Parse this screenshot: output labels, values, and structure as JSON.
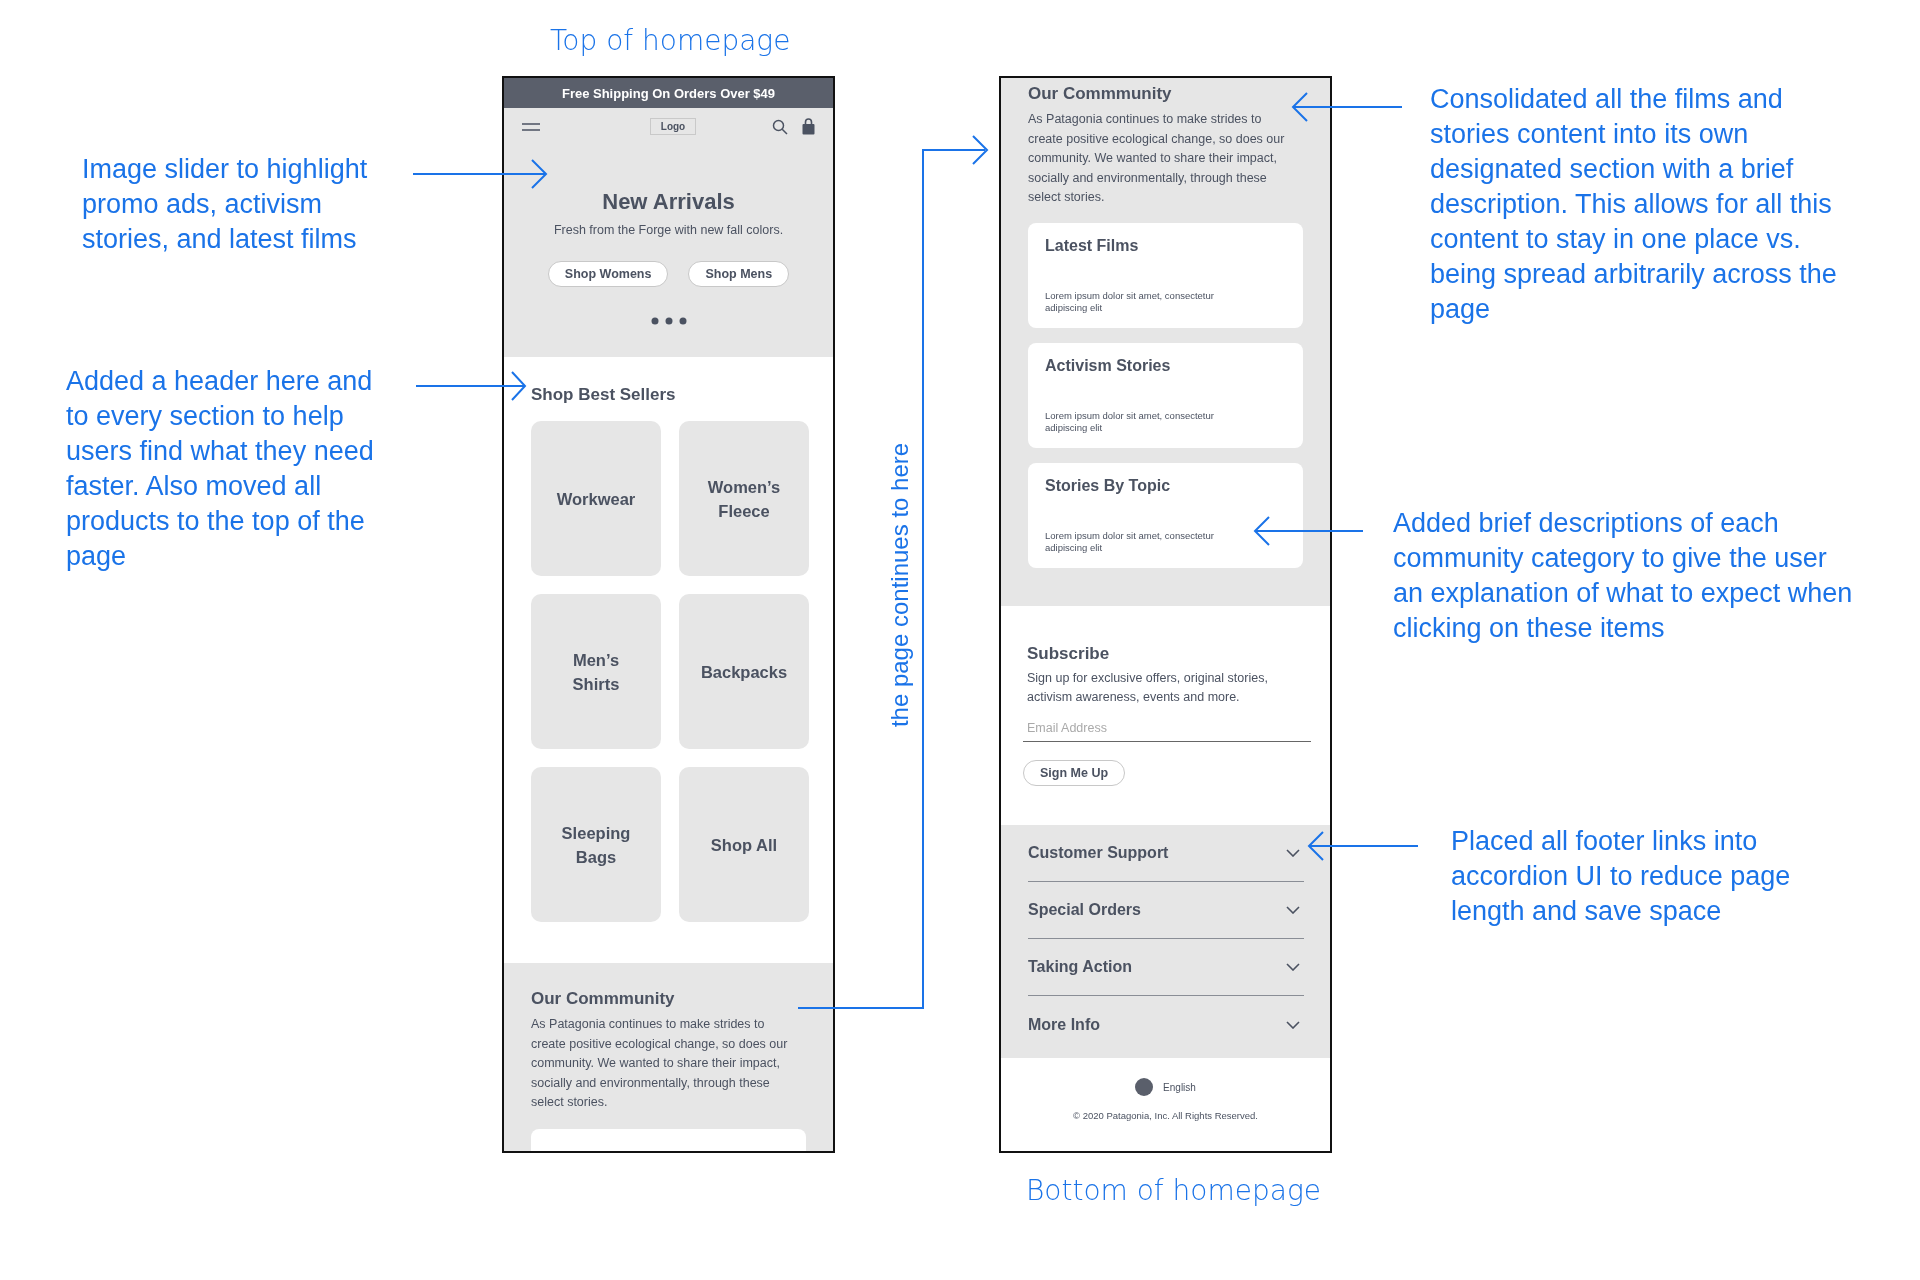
{
  "captions": [
    {
      "kind": "top",
      "text": "Top of homepage"
    },
    {
      "kind": "bottom",
      "text": "Bottom of homepage"
    }
  ],
  "notes": [
    {
      "kind": "slider",
      "text": "Image slider to highlight promo ads, activism stories, and latest films"
    },
    {
      "kind": "header",
      "text": "Added a header here and to every section to help users find what they need faster. Also moved all products to the top of the page"
    },
    {
      "kind": "continues",
      "text": "the page continues to here"
    },
    {
      "kind": "community",
      "text": "Consolidated all the films and stories content into its own designated section with a brief description. This allows for all this content to stay in one place vs. being spread arbitrarily across the page"
    },
    {
      "kind": "descriptions",
      "text": "Added brief descriptions of each community category to give the user an explanation of what to expect when clicking on these items"
    },
    {
      "kind": "footer",
      "text": "Placed all footer links into accordion UI to reduce page length and save space"
    }
  ],
  "top_page": {
    "banner": "Free Shipping On Orders Over $49",
    "logo": "Logo",
    "hero": {
      "title": "New Arrivals",
      "subtitle": "Fresh from the Forge with new fall colors.",
      "buttons": [
        "Shop Womens",
        "Shop Mens"
      ]
    },
    "best_sellers": {
      "title": "Shop Best Sellers",
      "tiles": [
        "Workwear",
        "Women’s Fleece",
        "Men’s Shirts",
        "Backpacks",
        "Sleeping Bags",
        "Shop All"
      ]
    },
    "community": {
      "title": "Our Commmunity",
      "text": "As Patagonia continues to make strides to create positive ecological change, so does our community. We wanted to share their impact, socially and environmentally, through these select stories."
    }
  },
  "bottom_page": {
    "community": {
      "title": "Our Commmunity",
      "text": "As Patagonia continues to make strides to create positive ecological change, so does our community. We wanted to share their impact, socially and environmentally, through these select stories.",
      "cards": [
        {
          "title": "Latest Films",
          "text": "Lorem ipsum dolor sit amet, consectetur adipiscing elit"
        },
        {
          "title": "Activism Stories",
          "text": "Lorem ipsum dolor sit amet, consectetur adipiscing elit"
        },
        {
          "title": "Stories By Topic",
          "text": "Lorem ipsum dolor sit amet, consectetur adipiscing elit"
        }
      ]
    },
    "subscribe": {
      "title": "Subscribe",
      "text": "Sign up for exclusive offers, original stories, activism awareness, events and more.",
      "placeholder": "Email Address",
      "button": "Sign Me Up"
    },
    "accordion": [
      {
        "label": "Customer Support",
        "expanded": false
      },
      {
        "label": "Special Orders",
        "expanded": false
      },
      {
        "label": "Taking Action",
        "expanded": false
      },
      {
        "label": "More Info",
        "expanded": false
      }
    ],
    "language": "English",
    "copyright": "© 2020 Patagonia, Inc. All Rights Reserved."
  }
}
